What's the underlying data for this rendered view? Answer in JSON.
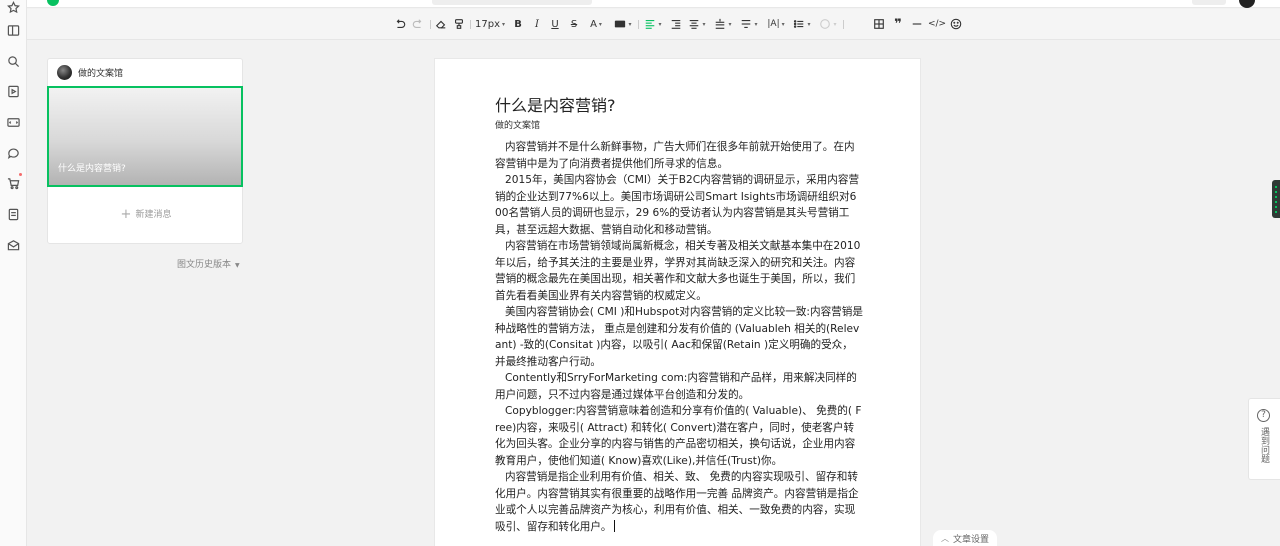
{
  "toolbar": {
    "font_size": "17px"
  },
  "article_list": {
    "author_name": "做的文案馆",
    "cover_title": "什么是内容营销?",
    "new_message_label": "新建消息",
    "history_label": "图文历史版本"
  },
  "article": {
    "title": "什么是内容营销?",
    "author": "做的文案馆",
    "paragraphs": [
      "内容营销并不是什么新鲜事物，广告大师们在很多年前就开始使用了。在内容营销中是为了向消费者提供他们所寻求的信息。",
      "2015年，美国内容协会（CMI）关于B2C内容营销的调研显示，采用内容营销的企业达到77%6以上。美国市场调研公司Smart Isights市场调研组织对600名营销人员的调研也显示，29 6%的受访者认为内容营销是其头号营销工具，甚至远超大数据、营销自动化和移动营销。",
      "内容营销在市场营销领域尚属新概念，相关专著及相关文献基本集中在2010年以后，给予其关注的主要是业界，学界对其尚缺乏深入的研究和关注。内容营销的概念最先在美国出现，相关著作和文献大多也诞生于美国，所以，我们首先看看美国业界有关内容营销的权威定义。",
      "美国内容营销协会( CMI )和Hubspot对内容营销的定义比较一致:内容营销是种战略性的营销方法，  重点是创建和分发有价值的 (Valuableh 相关的(Relevant) -致的(Consitat )内容，以吸引( Aac和保留(Retain )定义明确的受众，并最终推动客户行动。",
      "Contently和SrryForMarketing com:内容营销和产品样，用来解决同样的用户问题，只不过内容是通过媒体平台创造和分发的。",
      "Copyblogger:内容营销意味着创造和分享有价值的( Valuable)、 免费的( Free)内容，来吸引( Attract) 和转化( Convert)潜在客户，同时，使老客户转化为回头客。企业分享的内容与销售的产品密切相关，换句话说，企业用内容教育用户，使他们知道( Know)喜欢(Like),并信任(Trust)你。",
      "内容营销是指企业利用有价值、相关、致、  免费的内容实现吸引、留存和转化用户。内容营销其实有很重要的战略作用一完善 品牌资产。内容营销是指企业或个人以完善品牌资产为核心，利用有价值、相关、一致免费的内容，实现吸引、留存和转化用户。"
    ]
  },
  "help_label": "遇到问题",
  "settings_label": "文章设置"
}
